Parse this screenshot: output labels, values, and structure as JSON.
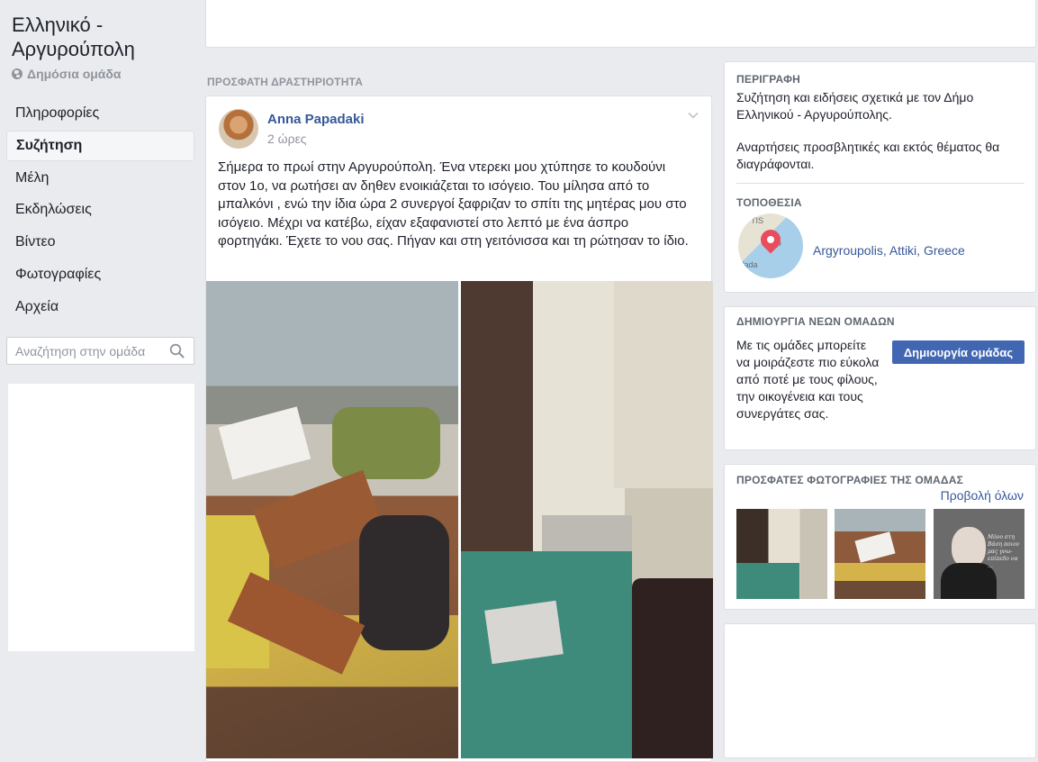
{
  "group": {
    "title": "Ελληνικό - Αργυρούπολη",
    "privacy": "Δημόσια ομάδα"
  },
  "nav": {
    "items": [
      {
        "label": "Πληροφορίες"
      },
      {
        "label": "Συζήτηση"
      },
      {
        "label": "Μέλη"
      },
      {
        "label": "Εκδηλώσεις"
      },
      {
        "label": "Βίντεο"
      },
      {
        "label": "Φωτογραφίες"
      },
      {
        "label": "Αρχεία"
      }
    ],
    "active_index": 1
  },
  "search": {
    "placeholder": "Αναζήτηση στην ομάδα"
  },
  "feed": {
    "section_label": "ΠΡΟΣΦΑΤΗ ΔΡΑΣΤΗΡΙΟΤΗΤΑ",
    "post": {
      "author": "Anna Papadaki",
      "time": "2 ώρες",
      "text": "Σήμερα το πρωί στην Αργυρούπολη. Ένα ντερεκι μου χτύπησε το κουδούνι στον 1ο, να ρωτήσει αν δηθεν ενοικιάζεται το ισόγειο. Του μίλησα από το μπαλκόνι , ενώ την ίδια ώρα 2 συνεργοί ξαφριζαν το σπίτι της μητέρας μου στο ισόγειο. Μέχρι να κατέβω, είχαν εξαφανιστεί στο λεπτό με ένα άσπρο φορτηγάκι. Έχετε το νου σας. Πήγαν και στη γειτόνισσα και τη ρώτησαν το ίδιο."
    }
  },
  "description": {
    "label": "ΠΕΡΙΓΡΑΦΗ",
    "line1": "Συζήτηση και ειδήσεις σχετικά με τον Δήμο Ελληνικού - Αργυρούπολης.",
    "line2": "Αναρτήσεις προσβλητικές και εκτός θέματος θα διαγράφονται.",
    "location_label": "ΤΟΠΟΘΕΣΙΑ",
    "location": "Argyroupolis, Attiki, Greece",
    "map_text_top": "TIS",
    "map_text_mid": "P",
    "map_text_bottom": "fada"
  },
  "create_group": {
    "label": "ΔΗΜΙΟΥΡΓΙΑ ΝΕΩΝ ΟΜΑΔΩΝ",
    "text": "Με τις ομάδες μπορείτε να μοιράζεστε πιο εύκολα από ποτέ με τους φίλους, την οικογένεια και τους συνεργάτες σας.",
    "button": "Δημιουργία ομάδας"
  },
  "recent_photos": {
    "label": "ΠΡΟΣΦΑΤΕΣ ΦΩΤΟΓΡΑΦΙΕΣ ΤΗΣ ΟΜΑΔΑΣ",
    "see_all": "Προβολή όλων",
    "quote_text": "Μόνο στη Βάση ποιον μας γνω- επίπεδο να ..."
  },
  "colors": {
    "link": "#365899",
    "button": "#4267b2",
    "background": "#e9ebee"
  }
}
